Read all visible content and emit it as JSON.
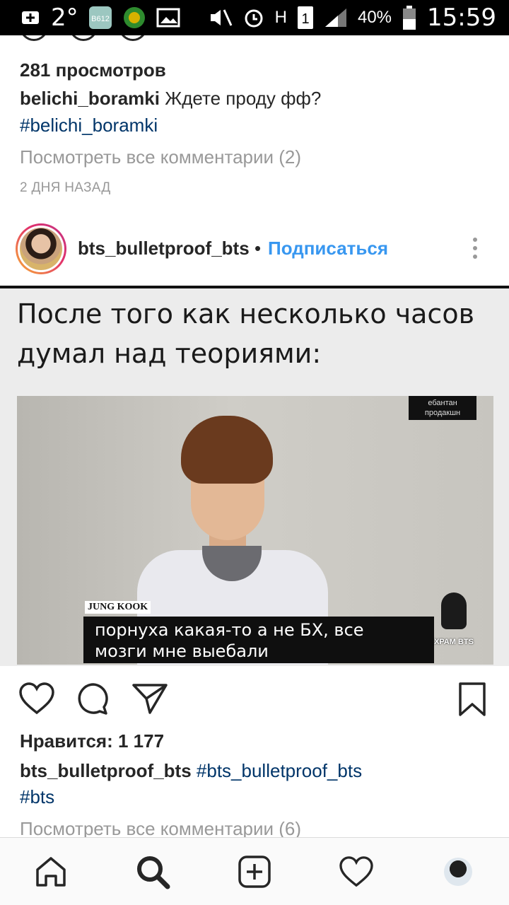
{
  "status_bar": {
    "temperature": "2°",
    "app_badge": "B612",
    "battery": "40%",
    "time": "15:59",
    "network": "H",
    "sim": "1"
  },
  "prev_post": {
    "views": "281 просмотров",
    "username": "belichi_boramki",
    "caption": "Ждете проду фф?",
    "hashtag": "#belichi_boramki",
    "view_comments": "Посмотреть все комментарии (2)",
    "time_ago": "2 ДНЯ НАЗАД"
  },
  "post": {
    "username": "bts_bulletproof_bts",
    "separator": "•",
    "follow_label": "Подписаться",
    "meme_line1": "После того как несколько часов",
    "meme_line2": "думал над теориями:",
    "watermark_line1": "ебантан",
    "watermark_line2": "продакшн",
    "name_tag": "JUNG KOOK",
    "subtitle_line1": "порнуха какая-то а не БХ, все",
    "subtitle_line2": "мозги мне выебали",
    "logo_text": "ХРАМ BTS",
    "likes": "Нравится: 1 177",
    "caption_user": "bts_bulletproof_bts",
    "caption_hashtag": "#bts_bulletproof_bts",
    "hashtag2": "#bts",
    "view_comments": "Посмотреть все комментарии (6)"
  },
  "icons": {
    "like": "heart-icon",
    "comment": "comment-icon",
    "share": "send-icon",
    "save": "bookmark-icon",
    "nav": [
      "home-icon",
      "search-icon",
      "add-post-icon",
      "activity-heart-icon",
      "profile-avatar"
    ]
  },
  "colors": {
    "link": "#003569",
    "follow": "#3897f0",
    "muted": "#999999"
  }
}
